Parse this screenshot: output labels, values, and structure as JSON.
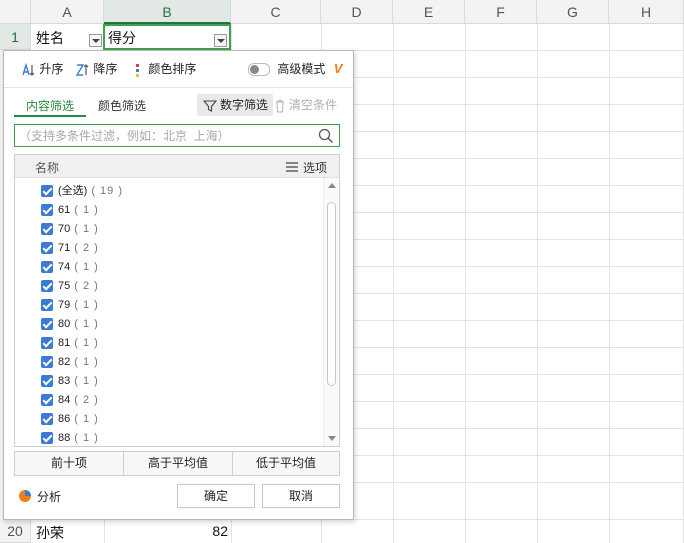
{
  "sheet": {
    "columns": [
      "A",
      "B",
      "C",
      "D",
      "E",
      "F",
      "G",
      "H"
    ],
    "row1": {
      "num": "1",
      "a": "姓名",
      "b": "得分"
    },
    "row20": {
      "num": "20",
      "a": "孙荣",
      "b": "82"
    }
  },
  "filter": {
    "toolbar": {
      "asc": "升序",
      "desc": "降序",
      "color_sort": "颜色排序",
      "advanced": "高级模式"
    },
    "tabs": {
      "content": "内容筛选",
      "color": "颜色筛选"
    },
    "number_filter": "数字筛选",
    "clear": "清空条件",
    "search": {
      "placeholder": "（支持多条件过滤，例如：北京  上海）"
    },
    "list_header": {
      "name": "名称",
      "options": "选项"
    },
    "items": [
      {
        "label": "(全选)",
        "count": "( 19 )"
      },
      {
        "label": "61",
        "count": "( 1 )"
      },
      {
        "label": "70",
        "count": "( 1 )"
      },
      {
        "label": "71",
        "count": "( 2 )"
      },
      {
        "label": "74",
        "count": "( 1 )"
      },
      {
        "label": "75",
        "count": "( 2 )"
      },
      {
        "label": "79",
        "count": "( 1 )"
      },
      {
        "label": "80",
        "count": "( 1 )"
      },
      {
        "label": "81",
        "count": "( 1 )"
      },
      {
        "label": "82",
        "count": "( 1 )"
      },
      {
        "label": "83",
        "count": "( 1 )"
      },
      {
        "label": "84",
        "count": "( 2 )"
      },
      {
        "label": "86",
        "count": "( 1 )"
      },
      {
        "label": "88",
        "count": "( 1 )"
      }
    ],
    "quick": {
      "top10": "前十项",
      "above_avg": "高于平均值",
      "below_avg": "低于平均值"
    },
    "analyze": "分析",
    "ok": "确定",
    "cancel": "取消"
  },
  "colors": {
    "accent": "#2b8a3e",
    "checkbox": "#3a7bd5",
    "advanced_v": "#f07c1a"
  }
}
